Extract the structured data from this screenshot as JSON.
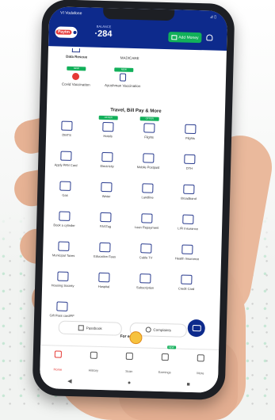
{
  "header": {
    "carrier": "VI Vodafone",
    "status_icons": "⊿ ▯",
    "logo_text": "Paytm",
    "subtitle": "BALANCE",
    "balance": "284",
    "add_money_label": "Add Money"
  },
  "top_row": {
    "items": [
      {
        "label": "Data Rescue",
        "icon": "rescue-icon"
      },
      {
        "label": "MADICARE",
        "icon": "medicine-icon"
      }
    ]
  },
  "vaccine_row": {
    "items": [
      {
        "label": "Covid Vaccination",
        "badge": "NEW",
        "icon": "vaccine-icon"
      },
      {
        "label": "Ayushman Vaccination",
        "badge": "NEW",
        "icon": "syringe-icon"
      }
    ]
  },
  "section": {
    "title": "Travel, Bill Pay & More",
    "tiles": [
      {
        "label": "DMTS",
        "icon": "bus-icon",
        "badge": ""
      },
      {
        "label": "Hotels",
        "icon": "hotel-icon",
        "badge": "OFFER"
      },
      {
        "label": "Flights",
        "icon": "flight-icon",
        "badge": "OFFER"
      },
      {
        "label": "Flights",
        "icon": "plane-icon",
        "badge": ""
      },
      {
        "label": "Apply PAN Card",
        "icon": "card-icon",
        "badge": ""
      },
      {
        "label": "Electricity",
        "icon": "bulb-icon",
        "badge": ""
      },
      {
        "label": "Mobile Postpaid",
        "icon": "mobile-icon",
        "badge": ""
      },
      {
        "label": "DTH",
        "icon": "dish-icon",
        "badge": ""
      },
      {
        "label": "Gas",
        "icon": "gas-icon",
        "badge": ""
      },
      {
        "label": "Water",
        "icon": "tap-icon",
        "badge": ""
      },
      {
        "label": "Landline",
        "icon": "phone-icon",
        "badge": ""
      },
      {
        "label": "Broadband",
        "icon": "router-icon",
        "badge": ""
      },
      {
        "label": "Book a cylinder",
        "icon": "cylinder-icon",
        "badge": ""
      },
      {
        "label": "FASTag",
        "icon": "car-icon",
        "badge": ""
      },
      {
        "label": "Loan Repayment",
        "icon": "loan-icon",
        "badge": ""
      },
      {
        "label": "LIFI Insurance",
        "icon": "umbrella-icon",
        "badge": ""
      },
      {
        "label": "Municipal Taxes",
        "icon": "building-icon",
        "badge": ""
      },
      {
        "label": "Education Fees",
        "icon": "school-icon",
        "badge": ""
      },
      {
        "label": "Cable TV",
        "icon": "tv-icon",
        "badge": ""
      },
      {
        "label": "Health Insurance",
        "icon": "shield-icon",
        "badge": ""
      },
      {
        "label": "Housing Society",
        "icon": "house-icon",
        "badge": ""
      },
      {
        "label": "Hospital",
        "icon": "hospital-icon",
        "badge": ""
      },
      {
        "label": "Subscription",
        "icon": "subscription-icon",
        "badge": ""
      },
      {
        "label": "Credit Card",
        "icon": "creditcard-icon",
        "badge": ""
      },
      {
        "label": "Gift Pass card/FF",
        "icon": "qr-icon",
        "badge": ""
      }
    ]
  },
  "pills": {
    "left": "Passbook",
    "right": "Complaints"
  },
  "promo": {
    "text": "For ers"
  },
  "bottom_nav": [
    {
      "label": "Home",
      "icon": "home-icon",
      "active": true
    },
    {
      "label": "History",
      "icon": "history-icon",
      "active": false
    },
    {
      "label": "Scan",
      "icon": "scan-icon",
      "active": false
    },
    {
      "label": "Earnings",
      "icon": "chart-icon",
      "active": false,
      "tag": "NEW"
    },
    {
      "label": "More",
      "icon": "more-icon",
      "active": false
    }
  ],
  "colors": {
    "brand_blue": "#0d2a8c",
    "accent_green": "#12b05a",
    "active_red": "#e53935"
  }
}
